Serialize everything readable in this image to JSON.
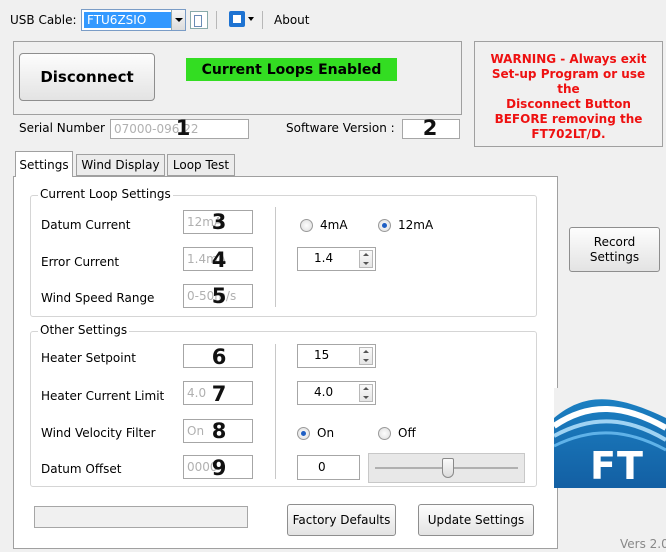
{
  "toolbar": {
    "usb_label": "USB Cable:",
    "usb_device": "FTU6ZSIO",
    "about": "About"
  },
  "connection": {
    "disconnect_button": "Disconnect",
    "status": "Current Loops Enabled",
    "status_color": "#33dd22"
  },
  "warning": {
    "lines": [
      "WARNING - Always exit",
      "Set-up Program or use the",
      "Disconnect Button",
      "BEFORE removing the",
      "FT702LT/D."
    ],
    "color": "#ee1111"
  },
  "info": {
    "serial_label": "Serial Number :",
    "serial_value": "07000-096,22",
    "serial_marker": "1",
    "software_label": "Software Version :",
    "software_value": "2",
    "software_marker": "2"
  },
  "tabs": [
    {
      "label": "Settings",
      "active": true
    },
    {
      "label": "Wind Display",
      "active": false
    },
    {
      "label": "Loop Test",
      "active": false
    }
  ],
  "current_loop": {
    "title": "Current Loop Settings",
    "datum_label": "Datum Current",
    "datum_value": "12mA",
    "datum_marker": "3",
    "error_label": "Error Current",
    "error_value": "1.4mA",
    "error_marker": "4",
    "wind_range_label": "Wind Speed Range",
    "wind_range_value": "0-50m/s",
    "wind_range_marker": "5",
    "radio_4ma": "4mA",
    "radio_12ma": "12mA",
    "error_spin": "1.4"
  },
  "other": {
    "title": "Other Settings",
    "heater_setpoint_label": "Heater Setpoint",
    "heater_setpoint_marker": "6",
    "heater_limit_label": "Heater Current Limit",
    "heater_limit_value": "4.0",
    "heater_limit_marker": "7",
    "filter_label": "Wind Velocity Filter",
    "filter_value": "On",
    "filter_marker": "8",
    "offset_label": "Datum Offset",
    "offset_value": "0000",
    "offset_marker": "9",
    "setpoint_spin": "15",
    "limit_spin": "4.0",
    "radio_on": "On",
    "radio_off": "Off",
    "offset_input": "0"
  },
  "buttons": {
    "factory_defaults": "Factory Defaults",
    "update_settings": "Update Settings",
    "record_settings": "Record Settings"
  },
  "logo_text": "FT",
  "version": "Vers 2.0"
}
